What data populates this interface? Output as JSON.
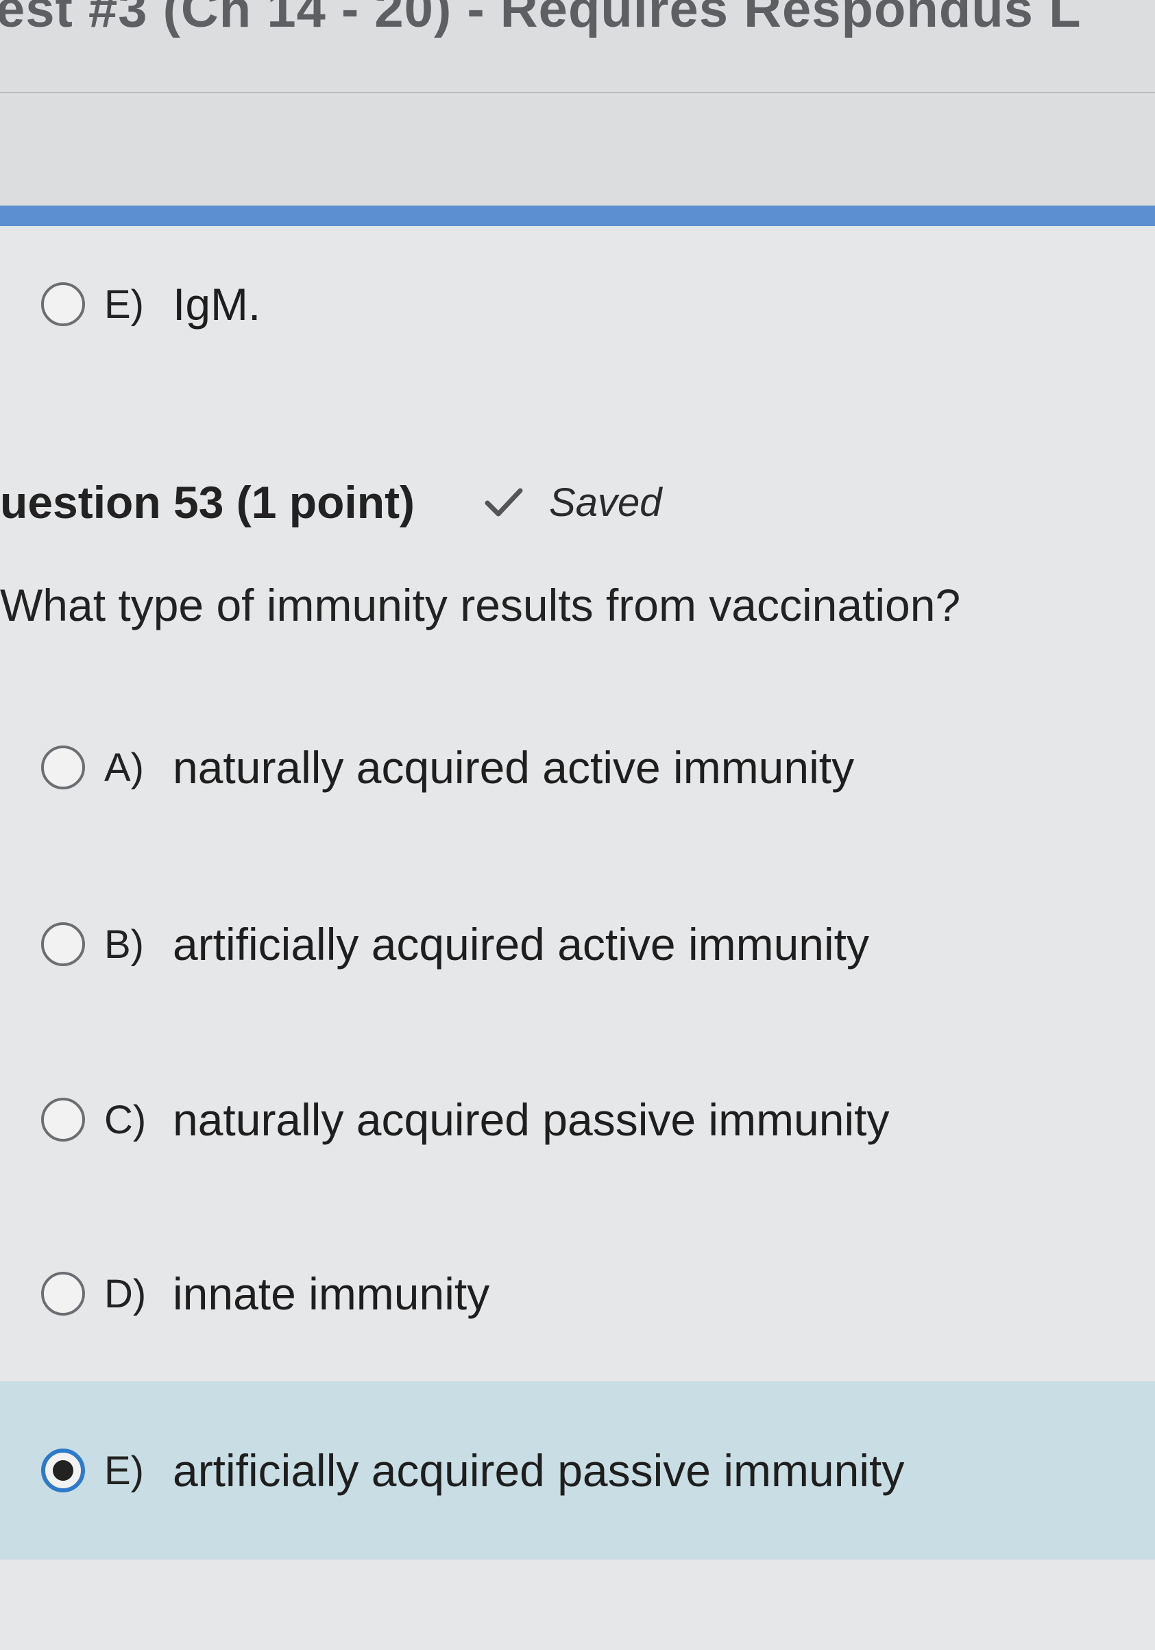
{
  "header": {
    "title": "est #3 (Ch 14 - 20) - Requires Respondus L"
  },
  "previous_question": {
    "option_e": {
      "letter": "E)",
      "text": "IgM."
    }
  },
  "question": {
    "label": "uestion 53 (1 point)",
    "status": "Saved",
    "prompt": "What type of immunity results from vaccination?",
    "options": [
      {
        "letter": "A)",
        "text": "naturally acquired active immunity",
        "selected": false
      },
      {
        "letter": "B)",
        "text": "artificially acquired active immunity",
        "selected": false
      },
      {
        "letter": "C)",
        "text": "naturally acquired passive immunity",
        "selected": false
      },
      {
        "letter": "D)",
        "text": "innate immunity",
        "selected": false
      },
      {
        "letter": "E)",
        "text": "artificially acquired passive immunity",
        "selected": true
      }
    ]
  },
  "colors": {
    "accent": "#5b8fd1",
    "selected_bg": "#c9dde4",
    "radio_checked": "#2e7ac9"
  }
}
